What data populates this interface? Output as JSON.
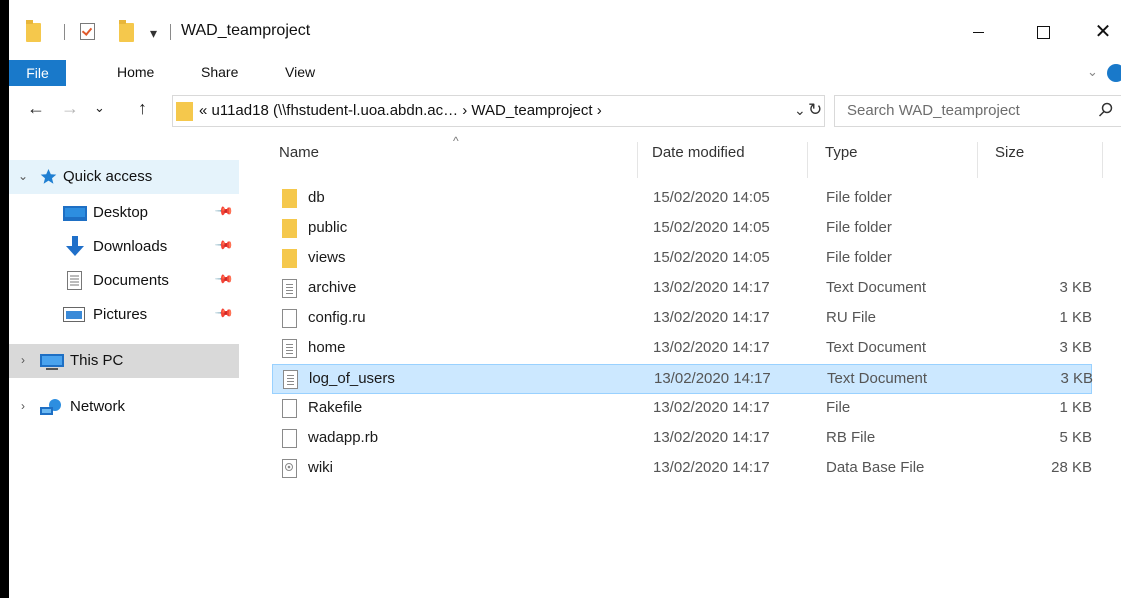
{
  "window": {
    "title": "WAD_teamproject",
    "qat_dropdown": "▾",
    "controls": {
      "minimize": "—",
      "maximize": "☐",
      "close": "✕"
    }
  },
  "ribbon": {
    "tabs": [
      "File",
      "Home",
      "Share",
      "View"
    ]
  },
  "nav": {
    "back": "←",
    "forward": "→",
    "recent": "⌄",
    "up": "↑",
    "path": "« u11ad18 (\\\\fhstudent-l.uoa.abdn.ac…  ›  WAD_teamproject  ›",
    "dropdown": "⌄",
    "refresh": "↻",
    "search_placeholder": "Search WAD_teamproject"
  },
  "sidebar": {
    "items": [
      {
        "label": "Quick access",
        "icon": "star-icon",
        "caret": "⌄"
      },
      {
        "label": "Desktop",
        "icon": "desktop-icon",
        "pinned": true
      },
      {
        "label": "Downloads",
        "icon": "download-icon",
        "pinned": true
      },
      {
        "label": "Documents",
        "icon": "documents-icon",
        "pinned": true
      },
      {
        "label": "Pictures",
        "icon": "pictures-icon",
        "pinned": true
      },
      {
        "label": "This PC",
        "icon": "pc-icon",
        "caret": "›"
      },
      {
        "label": "Network",
        "icon": "network-icon",
        "caret": "›"
      }
    ]
  },
  "columns": {
    "name": "Name",
    "date": "Date modified",
    "type": "Type",
    "size": "Size",
    "sort_indicator": "^"
  },
  "files": [
    {
      "name": "db",
      "date": "15/02/2020 14:05",
      "type": "File folder",
      "size": "",
      "icon": "folder-icon"
    },
    {
      "name": "public",
      "date": "15/02/2020 14:05",
      "type": "File folder",
      "size": "",
      "icon": "folder-icon"
    },
    {
      "name": "views",
      "date": "15/02/2020 14:05",
      "type": "File folder",
      "size": "",
      "icon": "folder-icon"
    },
    {
      "name": "archive",
      "date": "13/02/2020 14:17",
      "type": "Text Document",
      "size": "3 KB",
      "icon": "text-file-icon"
    },
    {
      "name": "config.ru",
      "date": "13/02/2020 14:17",
      "type": "RU File",
      "size": "1 KB",
      "icon": "blank-file-icon"
    },
    {
      "name": "home",
      "date": "13/02/2020 14:17",
      "type": "Text Document",
      "size": "3 KB",
      "icon": "text-file-icon"
    },
    {
      "name": "log_of_users",
      "date": "13/02/2020 14:17",
      "type": "Text Document",
      "size": "3 KB",
      "icon": "text-file-icon",
      "selected": true
    },
    {
      "name": "Rakefile",
      "date": "13/02/2020 14:17",
      "type": "File",
      "size": "1 KB",
      "icon": "blank-file-icon"
    },
    {
      "name": "wadapp.rb",
      "date": "13/02/2020 14:17",
      "type": "RB File",
      "size": "5 KB",
      "icon": "blank-file-icon"
    },
    {
      "name": "wiki",
      "date": "13/02/2020 14:17",
      "type": "Data Base File",
      "size": "28 KB",
      "icon": "database-file-icon"
    }
  ],
  "colors": {
    "accent": "#1979ca",
    "folder": "#f5c84c",
    "selection": "#cce8ff",
    "selection_border": "#99d1ff"
  }
}
